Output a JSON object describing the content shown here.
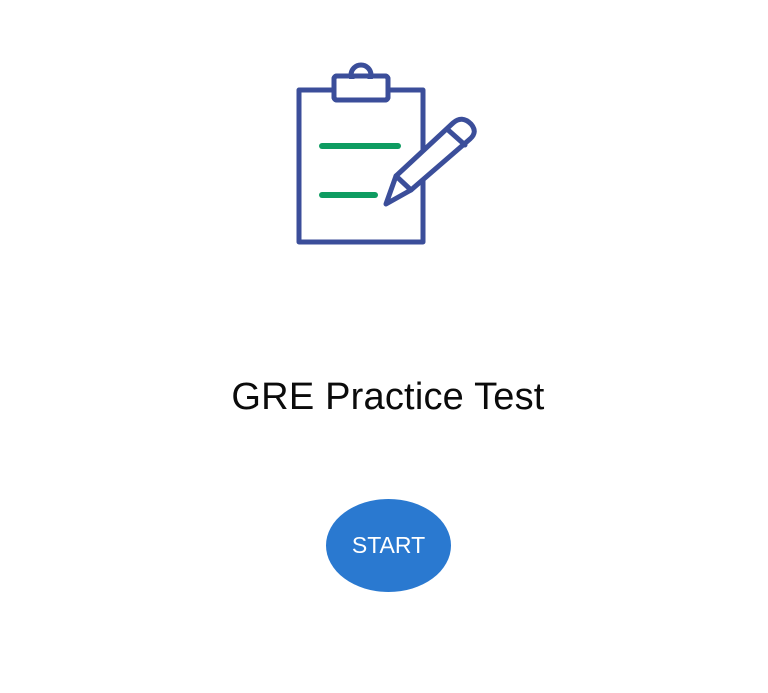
{
  "hero": {
    "icon": "clipboard-with-pencil-icon",
    "colors": {
      "outline": "#3b4e9a",
      "lines": "#0e9c61"
    }
  },
  "title": "GRE Practice Test",
  "start_button": {
    "label": "START",
    "color": "#2a79d0",
    "text_color": "#ffffff"
  }
}
